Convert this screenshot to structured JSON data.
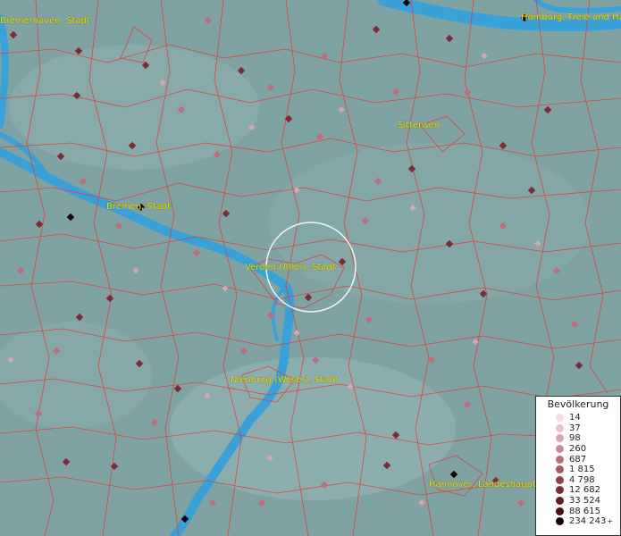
{
  "map": {
    "labels": [
      "Bremerhaven, Stadt",
      "Hamburg, Freie und Ha",
      "Sittensen",
      "Bremen, Stadt",
      "Verden (Aller), Stadt",
      "Nienburg (Weser), Stadt",
      "Hannover, Landeshaupt"
    ]
  },
  "legend": {
    "title": "Bevölkerung",
    "entries": [
      {
        "label": "14",
        "color": "#f3dde6"
      },
      {
        "label": "37",
        "color": "#e8c3cf"
      },
      {
        "label": "98",
        "color": "#d9a5b3"
      },
      {
        "label": "260",
        "color": "#c98c9a"
      },
      {
        "label": "687",
        "color": "#b86f7f"
      },
      {
        "label": "1 815",
        "color": "#a65867"
      },
      {
        "label": "4 798",
        "color": "#914150"
      },
      {
        "label": "12 682",
        "color": "#7a2c3a"
      },
      {
        "label": "33 524",
        "color": "#641d29"
      },
      {
        "label": "88 615",
        "color": "#4a1019"
      },
      {
        "label": "234 243",
        "color": "#1a0508"
      }
    ],
    "plus": "+"
  },
  "colors": {
    "water": "#3aa0d8",
    "border": "#e23a3a",
    "land": "#7fa3a3"
  }
}
